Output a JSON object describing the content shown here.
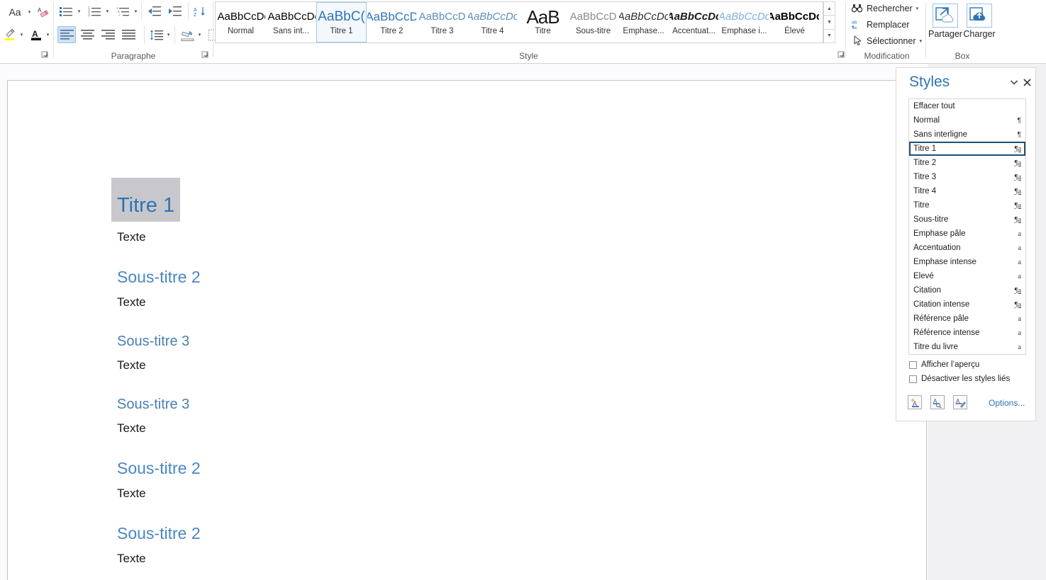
{
  "ribbon": {
    "groups": [
      {
        "label": "Paragraphe"
      },
      {
        "label": "Style"
      },
      {
        "label": "Modification"
      },
      {
        "label": "Box"
      }
    ],
    "font_group": {
      "change_case_label": "Aa",
      "clear_formatting_name": "clear-formatting-icon",
      "text_highlight_name": "text-highlight-color-icon",
      "font_color_name": "font-color-icon"
    },
    "paragraph_group": {
      "bullets": "bullet-list-icon",
      "numbering": "numbered-list-icon",
      "multilevel": "multilevel-list-icon",
      "decrease_indent": "decrease-indent-icon",
      "increase_indent": "increase-indent-icon",
      "sort": "sort-az-icon",
      "show_marks": "show-formatting-marks-icon",
      "align_left": "align-left-icon",
      "align_center": "align-center-icon",
      "align_right": "align-right-icon",
      "justify": "justify-icon",
      "line_spacing": "line-spacing-icon",
      "shading": "shading-icon",
      "borders": "borders-icon"
    },
    "gallery": [
      {
        "preview": "AaBbCcDc",
        "name": "Normal",
        "mark": "¶",
        "active": false,
        "color": "#000000",
        "italic": false,
        "bold": false
      },
      {
        "preview": "AaBbCcDc",
        "name": "Sans int...",
        "mark": "¶",
        "active": false,
        "color": "#000000",
        "italic": false,
        "bold": false
      },
      {
        "preview": "AaBbC(",
        "name": "Titre 1",
        "mark": "",
        "active": true,
        "color": "#2e74b5",
        "italic": false,
        "bold": false
      },
      {
        "preview": "AaBbCcD",
        "name": "Titre 2",
        "mark": "",
        "active": false,
        "color": "#2e74b5",
        "italic": false,
        "bold": false
      },
      {
        "preview": "AaBbCcD",
        "name": "Titre 3",
        "mark": "",
        "active": false,
        "color": "#5b8db8",
        "italic": false,
        "bold": false
      },
      {
        "preview": "AaBbCcDc",
        "name": "Titre 4",
        "mark": "",
        "active": false,
        "color": "#5b8db8",
        "italic": true,
        "bold": false
      },
      {
        "preview": "AaB",
        "name": "Titre",
        "mark": "",
        "active": false,
        "color": "#1a1a1a",
        "italic": false,
        "bold": false
      },
      {
        "preview": "AaBbCcD",
        "name": "Sous-titre",
        "mark": "",
        "active": false,
        "color": "#8a8a8a",
        "italic": false,
        "bold": false
      },
      {
        "preview": "AaBbCcDc",
        "name": "Emphase...",
        "mark": "",
        "active": false,
        "color": "#2b2b2b",
        "italic": true,
        "bold": false
      },
      {
        "preview": "AaBbCcDc",
        "name": "Accentuat...",
        "mark": "",
        "active": false,
        "color": "#1a1a1a",
        "italic": true,
        "bold": true
      },
      {
        "preview": "AaBbCcDc",
        "name": "Emphase i...",
        "mark": "",
        "active": false,
        "color": "#7cafe0",
        "italic": true,
        "bold": false
      },
      {
        "preview": "AaBbCcDc",
        "name": "Élevé",
        "mark": "",
        "active": false,
        "color": "#000000",
        "italic": false,
        "bold": true
      }
    ],
    "modification": {
      "find_label": "Rechercher",
      "replace_label": "Remplacer",
      "select_label": "Sélectionner"
    },
    "box": {
      "share_label": "Partager",
      "upload_label": "Charger"
    }
  },
  "document": {
    "blocks": [
      {
        "type": "titre1",
        "text": "Titre 1",
        "selected": true
      },
      {
        "type": "texte",
        "text": "Texte",
        "selected": false
      },
      {
        "type": "sous2",
        "text": "Sous-titre 2",
        "selected": false
      },
      {
        "type": "texte",
        "text": "Texte",
        "selected": false
      },
      {
        "type": "sous3",
        "text": "Sous-titre 3",
        "selected": false
      },
      {
        "type": "texte",
        "text": "Texte",
        "selected": false
      },
      {
        "type": "sous3",
        "text": "Sous-titre 3",
        "selected": false
      },
      {
        "type": "texte",
        "text": "Texte",
        "selected": false
      },
      {
        "type": "sous2",
        "text": "Sous-titre 2",
        "selected": false
      },
      {
        "type": "texte",
        "text": "Texte",
        "selected": false
      },
      {
        "type": "sous2",
        "text": "Sous-titre 2",
        "selected": false
      },
      {
        "type": "texte",
        "text": "Texte",
        "selected": false
      }
    ]
  },
  "styles_pane": {
    "title": "Styles",
    "collapse_icon": "chevron-down-icon",
    "close_icon": "close-icon",
    "items": [
      {
        "label": "Effacer tout",
        "mark": "",
        "mark_type": "none",
        "selected": false
      },
      {
        "label": "Normal",
        "mark": "¶",
        "mark_type": "pilcrow",
        "selected": false
      },
      {
        "label": "Sans interligne",
        "mark": "¶",
        "mark_type": "pilcrow",
        "selected": false
      },
      {
        "label": "Titre 1",
        "mark": "¶a",
        "mark_type": "linked",
        "selected": true
      },
      {
        "label": "Titre 2",
        "mark": "¶a",
        "mark_type": "linked",
        "selected": false
      },
      {
        "label": "Titre 3",
        "mark": "¶a",
        "mark_type": "linked",
        "selected": false
      },
      {
        "label": "Titre 4",
        "mark": "¶a",
        "mark_type": "linked",
        "selected": false
      },
      {
        "label": "Titre",
        "mark": "¶a",
        "mark_type": "linked",
        "selected": false
      },
      {
        "label": "Sous-titre",
        "mark": "¶a",
        "mark_type": "linked",
        "selected": false
      },
      {
        "label": "Emphase pâle",
        "mark": "a",
        "mark_type": "char",
        "selected": false
      },
      {
        "label": "Accentuation",
        "mark": "a",
        "mark_type": "char",
        "selected": false
      },
      {
        "label": "Emphase intense",
        "mark": "a",
        "mark_type": "char",
        "selected": false
      },
      {
        "label": "Élevé",
        "mark": "a",
        "mark_type": "char",
        "selected": false
      },
      {
        "label": "Citation",
        "mark": "¶a",
        "mark_type": "linked",
        "selected": false
      },
      {
        "label": "Citation intense",
        "mark": "¶a",
        "mark_type": "linked",
        "selected": false
      },
      {
        "label": "Référence pâle",
        "mark": "a",
        "mark_type": "char",
        "selected": false
      },
      {
        "label": "Référence intense",
        "mark": "a",
        "mark_type": "char",
        "selected": false
      },
      {
        "label": "Titre du livre",
        "mark": "a",
        "mark_type": "char",
        "selected": false
      }
    ],
    "checkbox_preview": "Afficher l’aperçu",
    "checkbox_disable_linked": "Désactiver les styles liés",
    "tool_new_style": "new-style-icon",
    "tool_style_inspector": "style-inspector-icon",
    "tool_manage_styles": "manage-styles-icon",
    "options_label": "Options..."
  },
  "colors": {
    "accent_blue": "#2e74b5",
    "selection_border": "#1f4e79",
    "gallery_active_border": "#a6c9ec",
    "text_selection": "#c8c8cc"
  }
}
